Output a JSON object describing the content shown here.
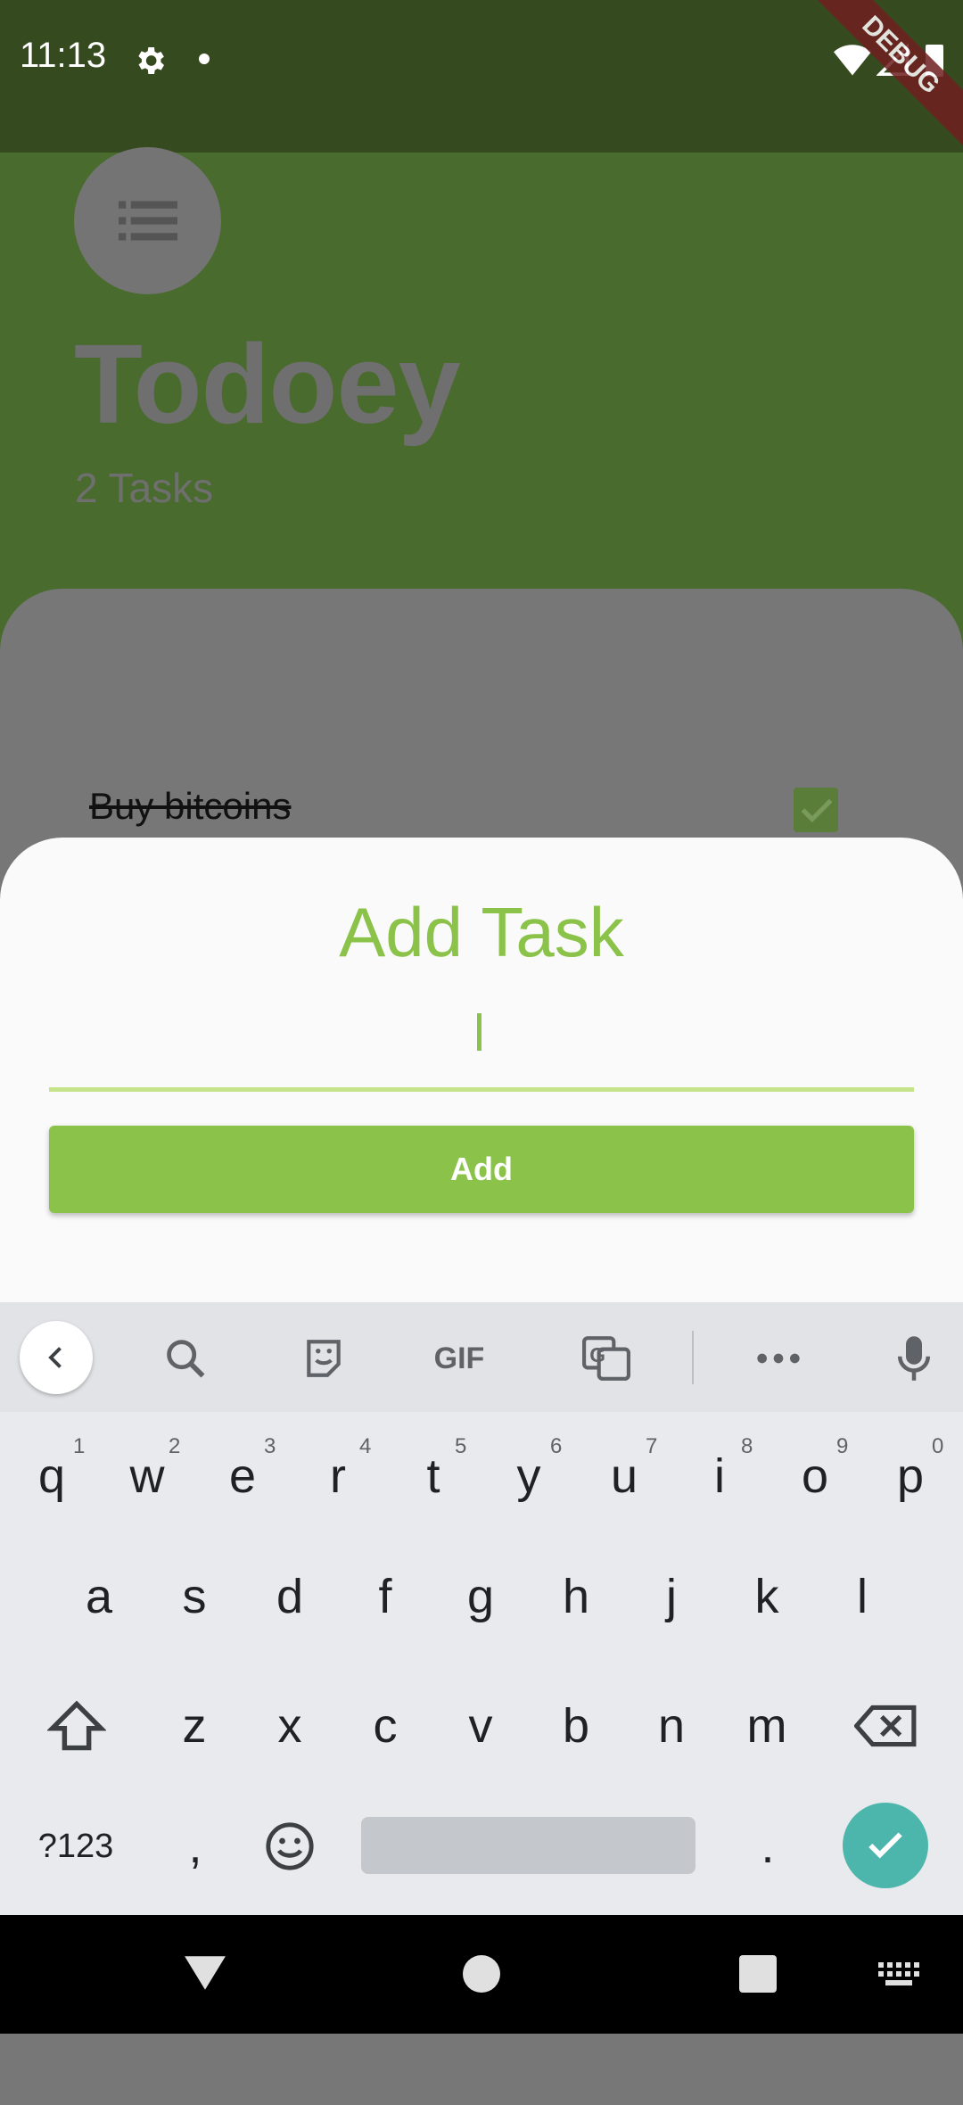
{
  "status": {
    "time": "11:13",
    "debug_label": "DEBUG"
  },
  "app": {
    "title": "Todoey",
    "task_count": "2 Tasks",
    "tasks": [
      {
        "label": "Buy bitcoins",
        "done": true
      }
    ]
  },
  "dialog": {
    "title": "Add Task",
    "input_value": "",
    "add_label": "Add"
  },
  "keyboard": {
    "row1": [
      "q",
      "w",
      "e",
      "r",
      "t",
      "y",
      "u",
      "i",
      "o",
      "p"
    ],
    "row1_hints": [
      "1",
      "2",
      "3",
      "4",
      "5",
      "6",
      "7",
      "8",
      "9",
      "0"
    ],
    "row2": [
      "a",
      "s",
      "d",
      "f",
      "g",
      "h",
      "j",
      "k",
      "l"
    ],
    "row3": [
      "z",
      "x",
      "c",
      "v",
      "b",
      "n",
      "m"
    ],
    "symbols_label": "?123",
    "comma": ",",
    "period": ".",
    "gif_label": "GIF"
  },
  "colors": {
    "accent": "#8bc34a",
    "enter": "#4db6ac"
  }
}
